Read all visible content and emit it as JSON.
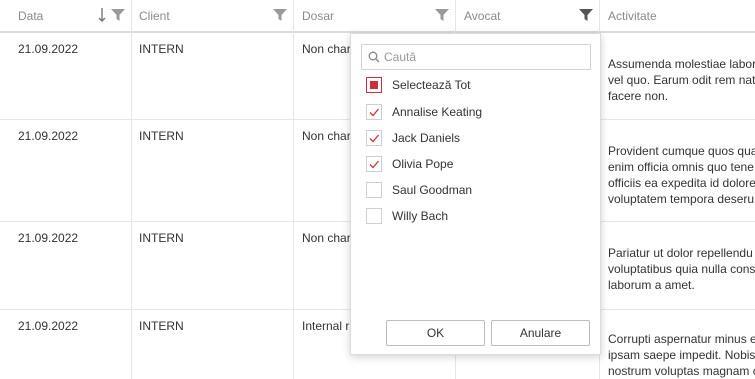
{
  "columns": [
    {
      "label": "Data"
    },
    {
      "label": "Client"
    },
    {
      "label": "Dosar"
    },
    {
      "label": "Avocat"
    },
    {
      "label": "Activitate"
    }
  ],
  "rows": [
    {
      "data": "21.09.2022",
      "client": "INTERN",
      "dosar": "Non char",
      "activitate": "Assumenda molestiae labor vel quo. Earum odit rem nat facere non."
    },
    {
      "data": "21.09.2022",
      "client": "INTERN",
      "dosar": "Non char",
      "activitate": "Provident cumque quos qua enim officia omnis quo tene officiis ea expedita id dolore voluptatem tempora deseru"
    },
    {
      "data": "21.09.2022",
      "client": "INTERN",
      "dosar": "Non char",
      "activitate": "Pariatur ut dolor repellendu voluptatibus quia nulla cons laborum a amet."
    },
    {
      "data": "21.09.2022",
      "client": "INTERN",
      "dosar": "Internal r",
      "activitate": "Corrupti aspernatur minus e ipsam saepe impedit. Nobis nostrum voluptas magnam c"
    }
  ],
  "filter_popup": {
    "search_placeholder": "Caută",
    "select_all_label": "Selectează Tot",
    "options": [
      {
        "label": "Annalise Keating",
        "checked": true
      },
      {
        "label": "Jack Daniels",
        "checked": true
      },
      {
        "label": "Olivia Pope",
        "checked": true
      },
      {
        "label": "Saul Goodman",
        "checked": false
      },
      {
        "label": "Willy Bach",
        "checked": false
      }
    ],
    "ok_label": "OK",
    "cancel_label": "Anulare"
  },
  "colors": {
    "accent": "#c8323a",
    "border": "#e6e6e6",
    "header_text": "#8a8a8a"
  },
  "icons": {
    "filter": "filter-icon",
    "sort": "sort-descending-icon",
    "search": "search-icon",
    "check": "checkmark-icon"
  }
}
